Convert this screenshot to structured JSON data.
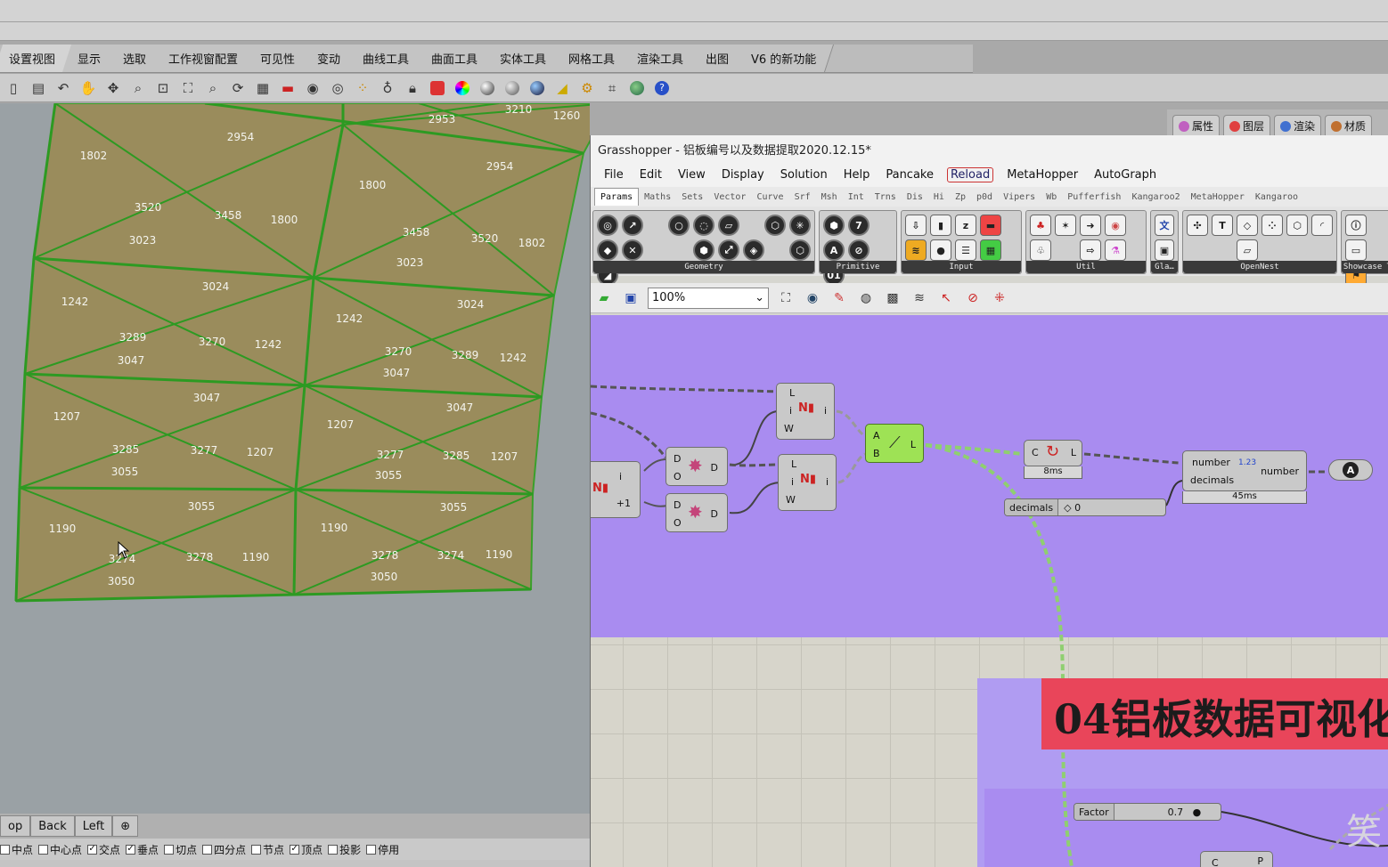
{
  "rhino": {
    "tabs": [
      "设置视图",
      "显示",
      "选取",
      "工作视窗配置",
      "可见性",
      "变动",
      "曲线工具",
      "曲面工具",
      "实体工具",
      "网格工具",
      "渲染工具",
      "出图",
      "V6 的新功能"
    ],
    "right_panel_tabs": [
      {
        "label": "属性",
        "color": "#c060c0"
      },
      {
        "label": "图层",
        "color": "#e04040"
      },
      {
        "label": "渲染",
        "color": "#4070d0"
      },
      {
        "label": "材质",
        "color": "#c07030"
      }
    ],
    "viewport_tabs": [
      "op",
      "Back",
      "Left",
      "⊕"
    ],
    "osnaps": [
      {
        "label": "中点",
        "checked": false
      },
      {
        "label": "中心点",
        "checked": false
      },
      {
        "label": "交点",
        "checked": true
      },
      {
        "label": "垂点",
        "checked": true
      },
      {
        "label": "切点",
        "checked": false
      },
      {
        "label": "四分点",
        "checked": false
      },
      {
        "label": "节点",
        "checked": false
      },
      {
        "label": "顶点",
        "checked": true
      },
      {
        "label": "投影",
        "checked": false
      },
      {
        "label": "停用",
        "checked": false
      }
    ],
    "panel_labels": [
      "2953",
      "3210",
      "1260",
      "2954",
      "1802",
      "2954",
      "1800",
      "3520",
      "3458",
      "1800",
      "3458",
      "3520",
      "1802",
      "3023",
      "3023",
      "3024",
      "1242",
      "3024",
      "3289",
      "3270",
      "1242",
      "1242",
      "3270",
      "3289",
      "1242",
      "3047",
      "3047",
      "3047",
      "1207",
      "3047",
      "3285",
      "3277",
      "1207",
      "1207",
      "3277",
      "3285",
      "1207",
      "3055",
      "3055",
      "3055",
      "3055",
      "1190",
      "1190",
      "3274",
      "3278",
      "1190",
      "3278",
      "3274",
      "1190",
      "3050",
      "3050"
    ]
  },
  "gh": {
    "title": "Grasshopper - 铝板编号以及数据提取2020.12.15*",
    "menu": [
      "File",
      "Edit",
      "View",
      "Display",
      "Solution",
      "Help",
      "Pancake",
      "Reload",
      "MetaHopper",
      "AutoGraph"
    ],
    "tabs": [
      "Params",
      "Maths",
      "Sets",
      "Vector",
      "Curve",
      "Srf",
      "Msh",
      "Int",
      "Trns",
      "Dis",
      "Hi",
      "Zp",
      "p0d",
      "Vipers",
      "Wb",
      "Pufferfish",
      "Kangaroo2",
      "MetaHopper",
      "Kangaroo"
    ],
    "ribbon_groups": [
      "Geometry",
      "Primitive",
      "Input",
      "Util",
      "Gla…",
      "OpenNest",
      "Showcase T"
    ],
    "zoom": "100%",
    "components": {
      "split_top": {
        "inputs": [
          "L",
          "i",
          "W"
        ],
        "output": "i"
      },
      "split_bottom": {
        "inputs": [
          "L",
          "i",
          "W"
        ],
        "output": "i"
      },
      "list_left": {
        "output_a": "i",
        "output_b": "+1"
      },
      "deconstruct_a": {
        "inputs": [
          "D",
          "O"
        ],
        "output": "D"
      },
      "deconstruct_b": {
        "inputs": [
          "D",
          "O"
        ],
        "output": "D"
      },
      "line": {
        "inputs": [
          "A",
          "B"
        ],
        "output": "L"
      },
      "length": {
        "input": "C",
        "output": "L",
        "time": "8ms"
      },
      "round": {
        "inputs": [
          "number",
          "decimals"
        ],
        "icon_text": "1.23",
        "output": "number",
        "time": "45ms"
      },
      "text_tag": "A"
    },
    "sliders": {
      "decimals": {
        "name": "decimals",
        "value": "◇ 0"
      },
      "factor": {
        "name": "Factor",
        "value": "0.7"
      }
    },
    "bottom_comp": {
      "left": "C",
      "right": "P"
    },
    "banner": "04铝板数据可视化",
    "watermark": "笑"
  }
}
